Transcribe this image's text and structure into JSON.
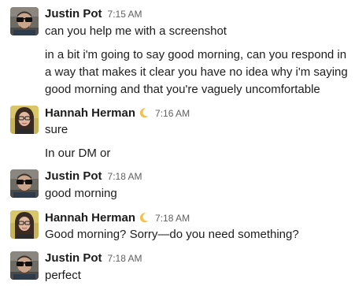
{
  "messages": [
    {
      "author": "Justin Pot",
      "time": "7:15 AM",
      "lines": [
        "can you help me with a screenshot"
      ],
      "followups": [
        [
          "in a bit i'm going to say good morning, can you respond in",
          "a way that makes it clear you have no idea why i'm saying",
          "good morning and that you're vaguely uncomfortable"
        ]
      ]
    },
    {
      "author": "Hannah Herman",
      "status_emoji": "crescent-moon-icon",
      "time": "7:16 AM",
      "lines": [
        "sure"
      ],
      "followups": [
        [
          "In our DM or"
        ]
      ]
    },
    {
      "author": "Justin Pot",
      "time": "7:18 AM",
      "lines": [
        "good morning"
      ]
    },
    {
      "author": "Hannah Herman",
      "status_emoji": "crescent-moon-icon",
      "time": "7:18 AM",
      "lines": [
        "Good morning? Sorry—do you need something?"
      ]
    },
    {
      "author": "Justin Pot",
      "time": "7:18 AM",
      "lines": [
        "perfect"
      ]
    }
  ],
  "colors": {
    "text": "#1d1c1d",
    "timestamp": "#616061",
    "moon": "#f2c14e"
  }
}
